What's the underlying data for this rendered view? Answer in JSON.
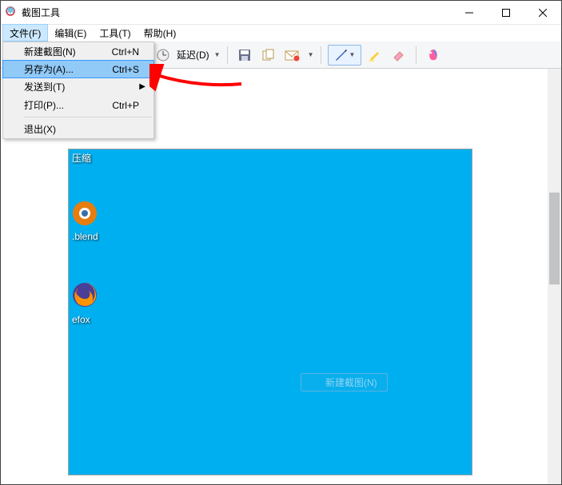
{
  "window": {
    "title": "截图工具"
  },
  "menubar": {
    "items": [
      {
        "label": "文件(F)",
        "active": true
      },
      {
        "label": "编辑(E)",
        "active": false
      },
      {
        "label": "工具(T)",
        "active": false
      },
      {
        "label": "帮助(H)",
        "active": false
      }
    ]
  },
  "file_menu": {
    "items": [
      {
        "label": "新建截图(N)",
        "shortcut": "Ctrl+N",
        "submenu": false,
        "highlight": false
      },
      {
        "label": "另存为(A)...",
        "shortcut": "Ctrl+S",
        "submenu": false,
        "highlight": true
      },
      {
        "label": "发送到(T)",
        "shortcut": "",
        "submenu": true,
        "highlight": false
      },
      {
        "label": "打印(P)...",
        "shortcut": "Ctrl+P",
        "submenu": false,
        "highlight": false
      },
      {
        "sep": true
      },
      {
        "label": "退出(X)",
        "shortcut": "",
        "submenu": false,
        "highlight": false
      }
    ]
  },
  "toolbar": {
    "delay_label": "延迟(D)",
    "icons": {
      "clock_icon": "clock",
      "save_icon": "save",
      "copy_icon": "copy",
      "mail_icon": "mail",
      "pen_icon": "pen",
      "highlighter_icon": "highlighter",
      "eraser_icon": "eraser",
      "paint3d_icon": "paint3d"
    }
  },
  "content": {
    "labels": {
      "compress": "压缩",
      "blend": ".blend",
      "fox": "efox"
    },
    "ghost_button": "新建截图(N)"
  },
  "colors": {
    "desktop_blue": "#00afef",
    "arrow_red": "#ff0000",
    "highlight_blue": "#91c9f7"
  }
}
